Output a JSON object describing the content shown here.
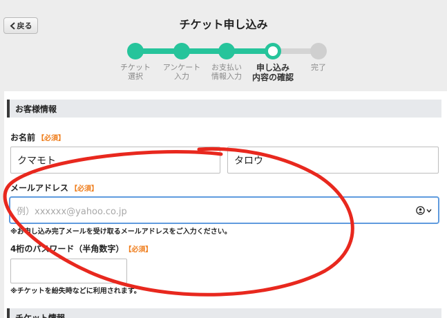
{
  "header": {
    "back_label": "戻る",
    "title": "チケット申し込み"
  },
  "steps": [
    {
      "label": "チケット\n選択",
      "state": "done"
    },
    {
      "label": "アンケート\n入力",
      "state": "done"
    },
    {
      "label": "お支払い\n情報入力",
      "state": "done"
    },
    {
      "label": "申し込み\n内容の確認",
      "state": "current"
    },
    {
      "label": "完了",
      "state": "todo"
    }
  ],
  "form": {
    "customer_section_title": "お客様情報",
    "name": {
      "label": "お名前",
      "required": "【必須】",
      "last_value": "クマモト",
      "first_value": "タロウ"
    },
    "email": {
      "label": "メールアドレス",
      "required": "【必須】",
      "placeholder": "例）xxxxxx@yahoo.co.jp",
      "note": "※お申し込み完了メールを受け取るメールアドレスをご入力ください。"
    },
    "password": {
      "label": "4桁のパスワード（半角数字）",
      "required": "【必須】",
      "value": "",
      "note": "※チケットを紛失時などに利用されます。"
    },
    "ticket_section_title": "チケット情報"
  },
  "colors": {
    "accent": "#26c49b",
    "required": "#ef7e1d",
    "focus": "#5f9bde",
    "annotation": "#e8281e"
  }
}
